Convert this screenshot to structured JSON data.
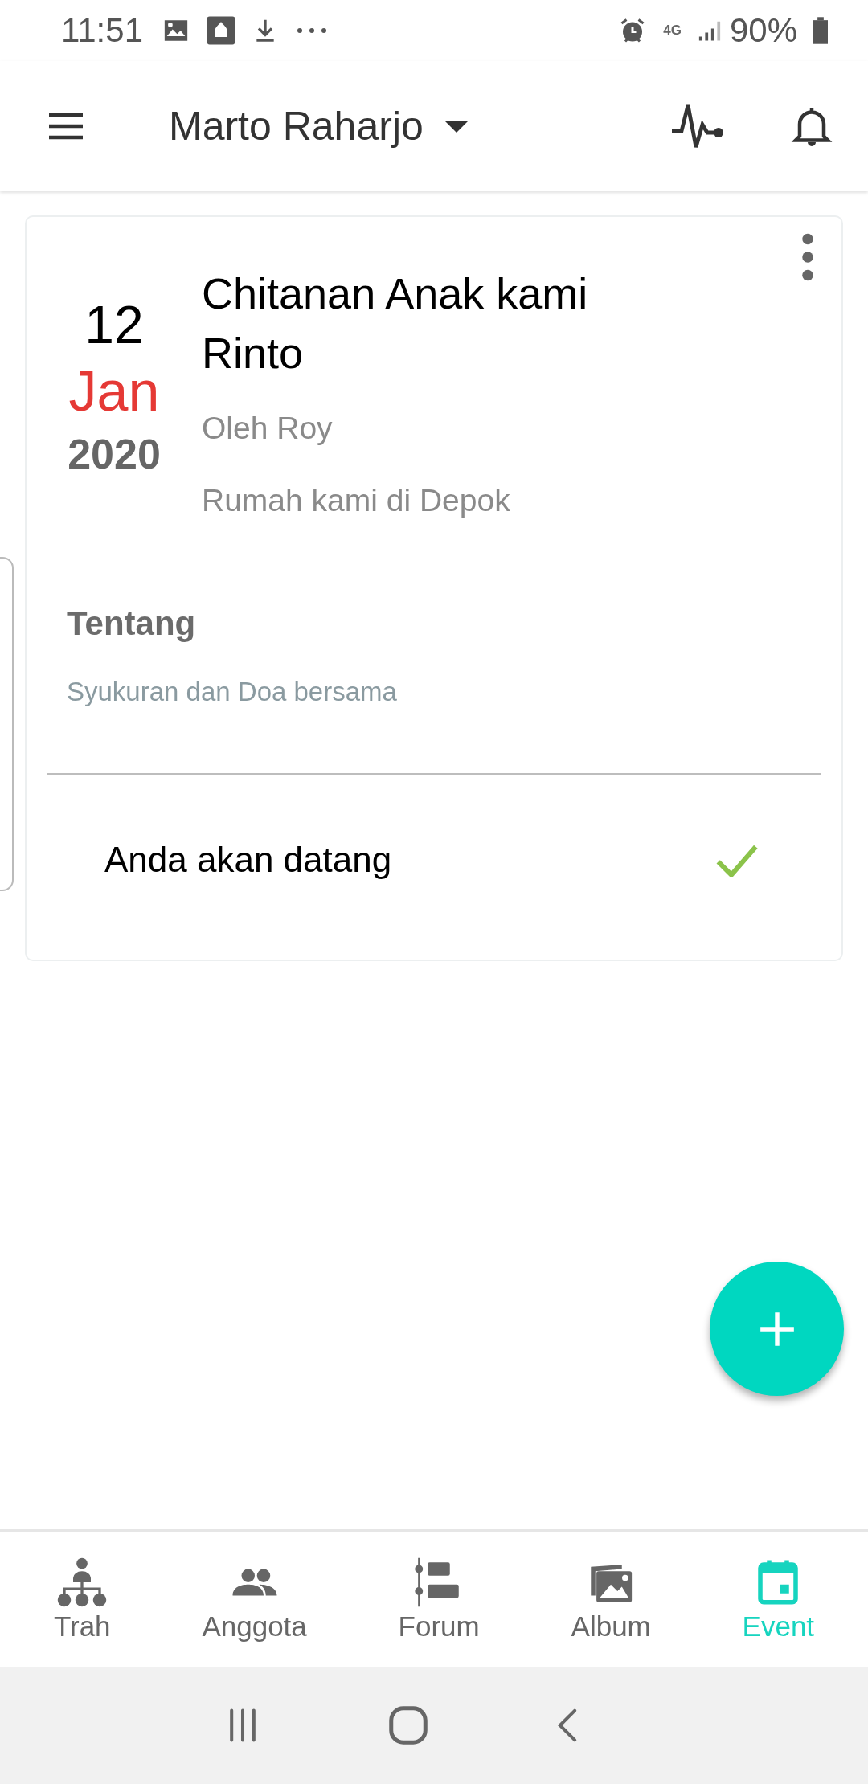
{
  "status_bar": {
    "time": "11:51",
    "network": "4G",
    "battery": "90%"
  },
  "app_bar": {
    "title": "Marto Raharjo"
  },
  "event": {
    "day": "12",
    "month": "Jan",
    "year": "2020",
    "title": "Chitanan Anak kami Rinto",
    "organizer": "Oleh Roy",
    "location": "Rumah kami di Depok",
    "about_heading": "Tentang",
    "about": "Syukuran dan Doa bersama",
    "rsvp": {
      "label": "Anda akan datang",
      "checked": true
    }
  },
  "bottom_nav": [
    {
      "label": "Trah",
      "kind": "tree",
      "selected": false
    },
    {
      "label": "Anggota",
      "kind": "people",
      "selected": false
    },
    {
      "label": "Forum",
      "kind": "forum",
      "selected": false
    },
    {
      "label": "Album",
      "kind": "album",
      "selected": false
    },
    {
      "label": "Event",
      "kind": "event",
      "selected": true
    }
  ]
}
